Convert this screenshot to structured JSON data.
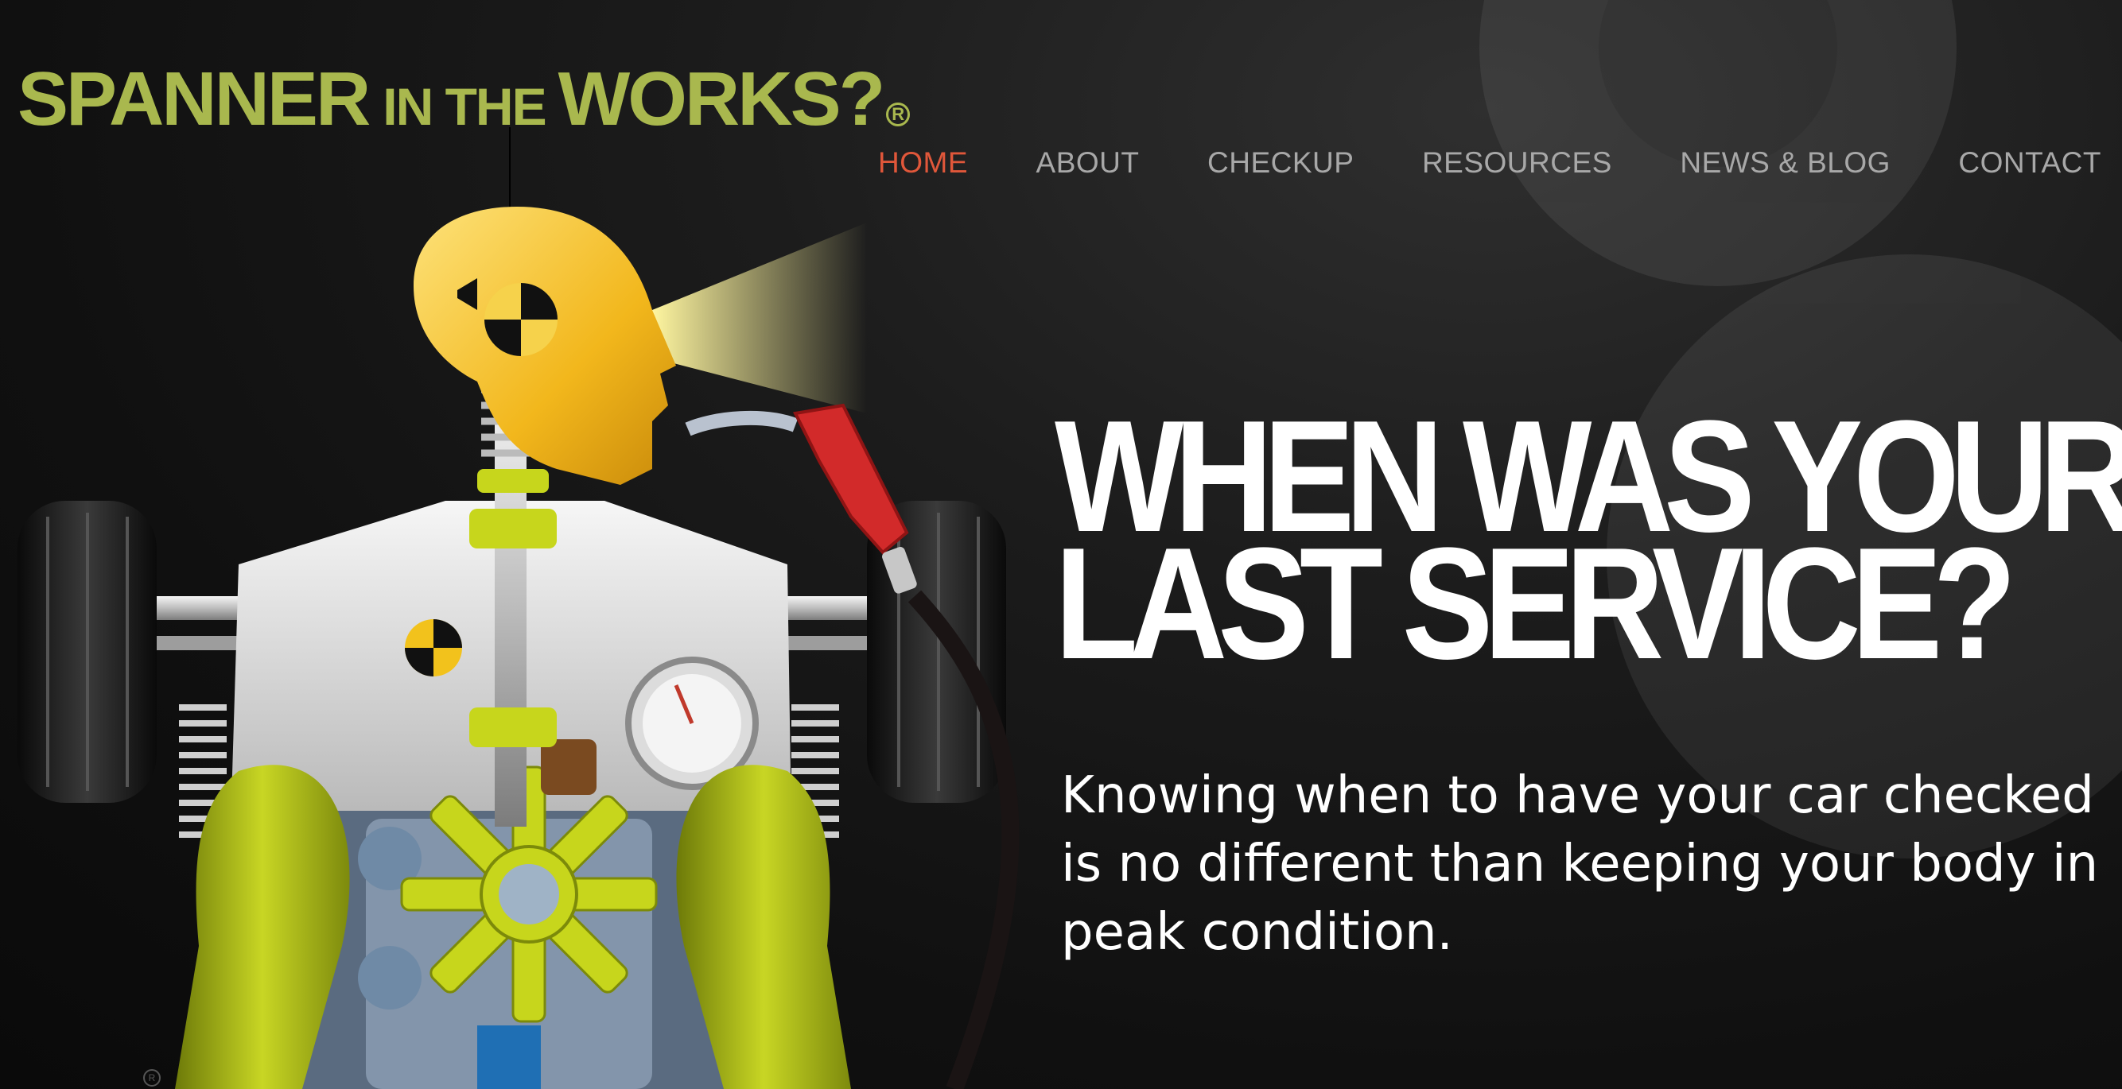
{
  "logo": {
    "part1": "SPANNER",
    "part2": "IN THE",
    "part3": "WORKS?",
    "reg_mark": "R",
    "color": "#a9b84e"
  },
  "nav": {
    "items": [
      {
        "label": "HOME",
        "active": true
      },
      {
        "label": "ABOUT",
        "active": false
      },
      {
        "label": "CHECKUP",
        "active": false
      },
      {
        "label": "RESOURCES",
        "active": false
      },
      {
        "label": "NEWS & BLOG",
        "active": false
      },
      {
        "label": "CONTACT",
        "active": false
      }
    ],
    "active_color": "#e0573a",
    "color": "#a8a8a8"
  },
  "hero": {
    "headline_line1": "WHEN WAS YOUR",
    "headline_line2": "LAST SERVICE?",
    "subtext": "Knowing when to have your car checked is no different than keeping your body in peak condition."
  },
  "illustration": {
    "name": "crash-test-dummy-car-chassis",
    "small_reg_mark": "R"
  }
}
